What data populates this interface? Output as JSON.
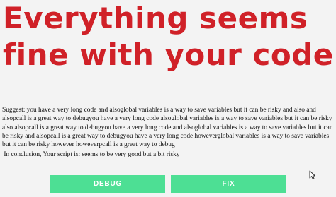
{
  "headline": {
    "line1": "Everything seems",
    "line2": "fine with your code!"
  },
  "suggestion": {
    "text": "Suggest: you have a very long code and alsoglobal variables is a way to save variables but it can be risky and also and alsopcall is a great way to debugyou have a very long code alsoglobal variables is a way to save variables but it can be risky also alsopcall is a great way to debugyou have a very long code and alsoglobal variables is a way to save variables but it can be risky and alsopcall is a great way to debugyou have a very long code howeverglobal variables is a way to save variables but it can be risky however howeverpcall is a great way to debug",
    "conclusion": " In conclusion, Your script is: seems to be very good but a bit risky"
  },
  "buttons": {
    "debug_label": "DEBUG",
    "fix_label": "FIX"
  },
  "colors": {
    "headline": "#d02128",
    "button": "#4ddf94",
    "background": "#f3f3f3"
  },
  "icons": {
    "cursor": "mouse-pointer-icon"
  }
}
